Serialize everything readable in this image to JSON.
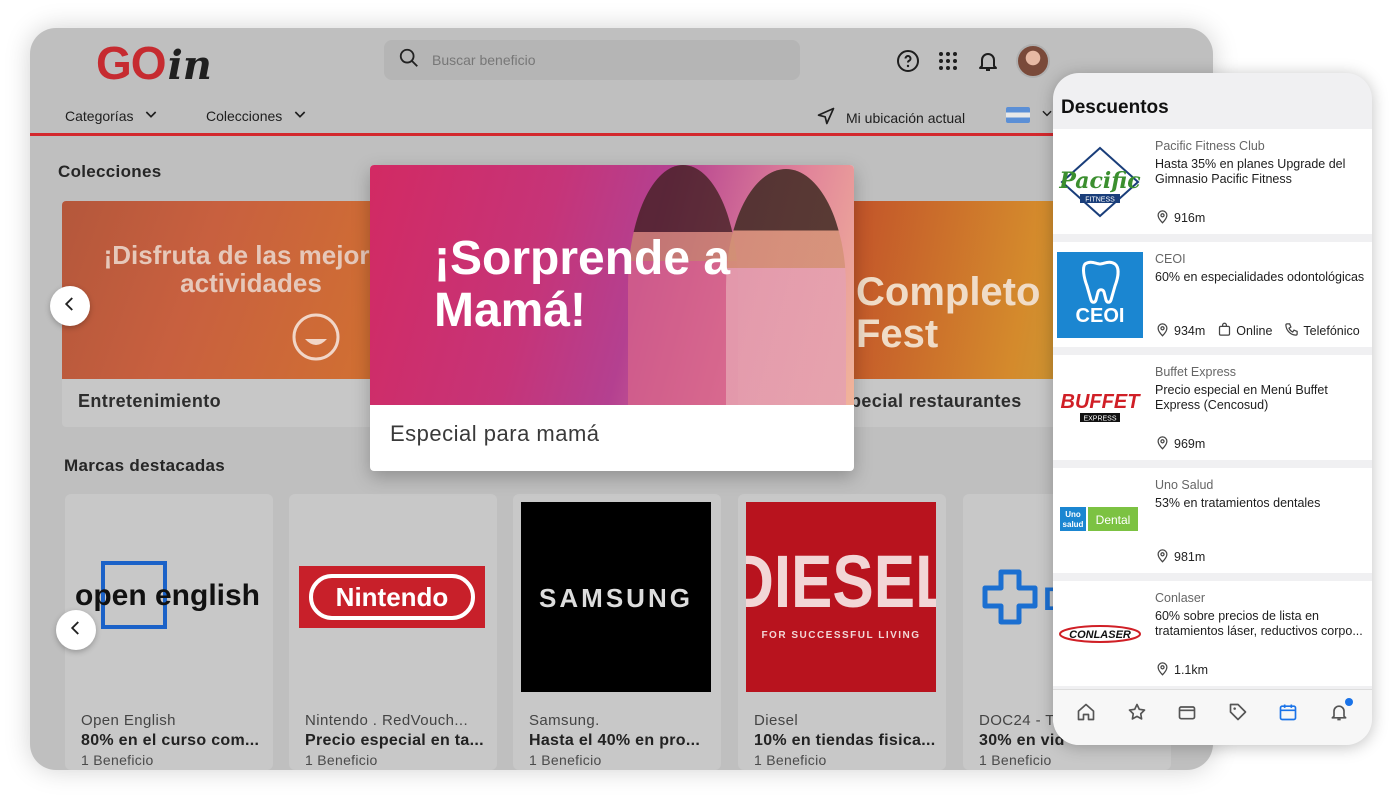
{
  "desktop": {
    "logo": {
      "go": "GO",
      "in": "in"
    },
    "search": {
      "placeholder": "Buscar beneficio"
    },
    "nav": {
      "categories": "Categorías",
      "collections": "Colecciones",
      "location": "Mi ubicación actual"
    },
    "collections_title": "Colecciones",
    "collections": [
      {
        "label": "Entretenimiento",
        "image_text": "¡Disfruta de las mejores actividades"
      },
      {
        "label": "Especial para mamá",
        "image_text": "¡Sorprende a Mamá!"
      },
      {
        "label": "pecial restaurantes",
        "image_text": "Completo Fest"
      }
    ],
    "brands_title": "Marcas destacadas",
    "brands": [
      {
        "name": "Open English",
        "offer": "80% en el curso com...",
        "count": "1 Beneficio",
        "logo": "open english"
      },
      {
        "name": "Nintendo . RedVouch...",
        "offer": "Precio especial en ta...",
        "count": "1 Beneficio",
        "logo": "Nintendo"
      },
      {
        "name": "Samsung.",
        "offer": "Hasta el 40% en pro...",
        "count": "1 Beneficio",
        "logo": "SAMSUNG"
      },
      {
        "name": "Diesel",
        "offer": "10% en tiendas fisica...",
        "count": "1 Beneficio",
        "logo": "DIESEL",
        "logo_sub": "FOR SUCCESSFUL LIVING"
      },
      {
        "name": "DOC24 - T",
        "offer": "30% en  vid",
        "count": "1 Beneficio",
        "logo": "D"
      }
    ]
  },
  "phone": {
    "title": "Descuentos",
    "deals": [
      {
        "brand": "Pacific Fitness Club",
        "text": "Hasta 35% en planes Upgrade del Gimnasio Pacific Fitness",
        "distance": "916m",
        "logo": "Pacific",
        "logo_sub": "FITNESS"
      },
      {
        "brand": "CEOI",
        "text": "60% en especialidades odontológicas",
        "distance": "934m",
        "online": "Online",
        "phone": "Telefónico",
        "logo": "CEOI"
      },
      {
        "brand": "Buffet Express",
        "text": "Precio especial en Menú Buffet Express (Cencosud)",
        "distance": "969m",
        "logo": "BUFFET",
        "logo_sub": "EXPRESS"
      },
      {
        "brand": "Uno Salud",
        "text": "53% en tratamientos dentales",
        "distance": "981m",
        "logo": "Uno salud",
        "logo_sub": "Dental"
      },
      {
        "brand": "Conlaser",
        "text": "60% sobre precios de lista en tratamientos láser, reductivos corpo...",
        "distance": "1.1km",
        "logo": "CONLASER"
      }
    ]
  },
  "colors": {
    "brand_red": "#c62b30",
    "accent_blue": "#1a73e8"
  }
}
